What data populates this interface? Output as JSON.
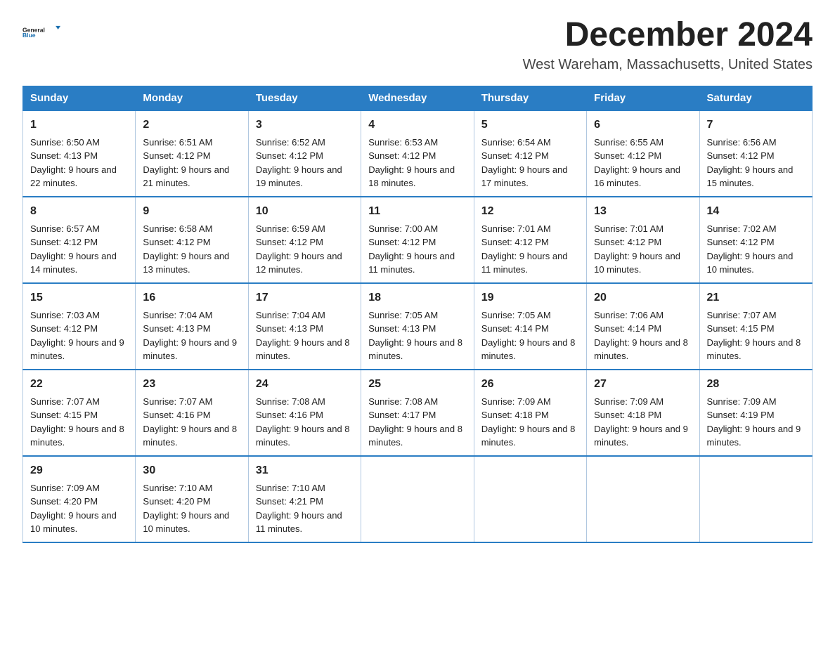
{
  "header": {
    "logo_general": "General",
    "logo_blue": "Blue",
    "month_title": "December 2024",
    "location": "West Wareham, Massachusetts, United States"
  },
  "weekdays": [
    "Sunday",
    "Monday",
    "Tuesday",
    "Wednesday",
    "Thursday",
    "Friday",
    "Saturday"
  ],
  "weeks": [
    [
      {
        "day": "1",
        "sunrise": "6:50 AM",
        "sunset": "4:13 PM",
        "daylight": "9 hours and 22 minutes."
      },
      {
        "day": "2",
        "sunrise": "6:51 AM",
        "sunset": "4:12 PM",
        "daylight": "9 hours and 21 minutes."
      },
      {
        "day": "3",
        "sunrise": "6:52 AM",
        "sunset": "4:12 PM",
        "daylight": "9 hours and 19 minutes."
      },
      {
        "day": "4",
        "sunrise": "6:53 AM",
        "sunset": "4:12 PM",
        "daylight": "9 hours and 18 minutes."
      },
      {
        "day": "5",
        "sunrise": "6:54 AM",
        "sunset": "4:12 PM",
        "daylight": "9 hours and 17 minutes."
      },
      {
        "day": "6",
        "sunrise": "6:55 AM",
        "sunset": "4:12 PM",
        "daylight": "9 hours and 16 minutes."
      },
      {
        "day": "7",
        "sunrise": "6:56 AM",
        "sunset": "4:12 PM",
        "daylight": "9 hours and 15 minutes."
      }
    ],
    [
      {
        "day": "8",
        "sunrise": "6:57 AM",
        "sunset": "4:12 PM",
        "daylight": "9 hours and 14 minutes."
      },
      {
        "day": "9",
        "sunrise": "6:58 AM",
        "sunset": "4:12 PM",
        "daylight": "9 hours and 13 minutes."
      },
      {
        "day": "10",
        "sunrise": "6:59 AM",
        "sunset": "4:12 PM",
        "daylight": "9 hours and 12 minutes."
      },
      {
        "day": "11",
        "sunrise": "7:00 AM",
        "sunset": "4:12 PM",
        "daylight": "9 hours and 11 minutes."
      },
      {
        "day": "12",
        "sunrise": "7:01 AM",
        "sunset": "4:12 PM",
        "daylight": "9 hours and 11 minutes."
      },
      {
        "day": "13",
        "sunrise": "7:01 AM",
        "sunset": "4:12 PM",
        "daylight": "9 hours and 10 minutes."
      },
      {
        "day": "14",
        "sunrise": "7:02 AM",
        "sunset": "4:12 PM",
        "daylight": "9 hours and 10 minutes."
      }
    ],
    [
      {
        "day": "15",
        "sunrise": "7:03 AM",
        "sunset": "4:12 PM",
        "daylight": "9 hours and 9 minutes."
      },
      {
        "day": "16",
        "sunrise": "7:04 AM",
        "sunset": "4:13 PM",
        "daylight": "9 hours and 9 minutes."
      },
      {
        "day": "17",
        "sunrise": "7:04 AM",
        "sunset": "4:13 PM",
        "daylight": "9 hours and 8 minutes."
      },
      {
        "day": "18",
        "sunrise": "7:05 AM",
        "sunset": "4:13 PM",
        "daylight": "9 hours and 8 minutes."
      },
      {
        "day": "19",
        "sunrise": "7:05 AM",
        "sunset": "4:14 PM",
        "daylight": "9 hours and 8 minutes."
      },
      {
        "day": "20",
        "sunrise": "7:06 AM",
        "sunset": "4:14 PM",
        "daylight": "9 hours and 8 minutes."
      },
      {
        "day": "21",
        "sunrise": "7:07 AM",
        "sunset": "4:15 PM",
        "daylight": "9 hours and 8 minutes."
      }
    ],
    [
      {
        "day": "22",
        "sunrise": "7:07 AM",
        "sunset": "4:15 PM",
        "daylight": "9 hours and 8 minutes."
      },
      {
        "day": "23",
        "sunrise": "7:07 AM",
        "sunset": "4:16 PM",
        "daylight": "9 hours and 8 minutes."
      },
      {
        "day": "24",
        "sunrise": "7:08 AM",
        "sunset": "4:16 PM",
        "daylight": "9 hours and 8 minutes."
      },
      {
        "day": "25",
        "sunrise": "7:08 AM",
        "sunset": "4:17 PM",
        "daylight": "9 hours and 8 minutes."
      },
      {
        "day": "26",
        "sunrise": "7:09 AM",
        "sunset": "4:18 PM",
        "daylight": "9 hours and 8 minutes."
      },
      {
        "day": "27",
        "sunrise": "7:09 AM",
        "sunset": "4:18 PM",
        "daylight": "9 hours and 9 minutes."
      },
      {
        "day": "28",
        "sunrise": "7:09 AM",
        "sunset": "4:19 PM",
        "daylight": "9 hours and 9 minutes."
      }
    ],
    [
      {
        "day": "29",
        "sunrise": "7:09 AM",
        "sunset": "4:20 PM",
        "daylight": "9 hours and 10 minutes."
      },
      {
        "day": "30",
        "sunrise": "7:10 AM",
        "sunset": "4:20 PM",
        "daylight": "9 hours and 10 minutes."
      },
      {
        "day": "31",
        "sunrise": "7:10 AM",
        "sunset": "4:21 PM",
        "daylight": "9 hours and 11 minutes."
      },
      null,
      null,
      null,
      null
    ]
  ]
}
